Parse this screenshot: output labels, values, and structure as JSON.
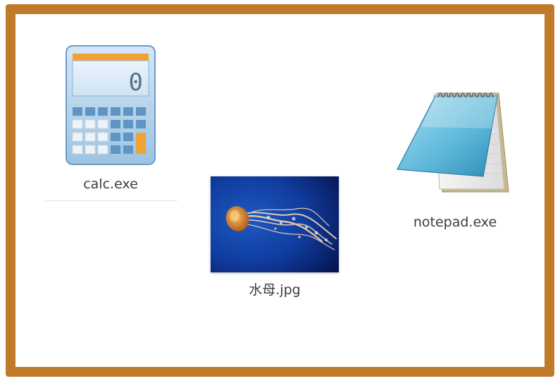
{
  "desktop": {
    "items": [
      {
        "label": "calc.exe",
        "icon": "calculator-icon",
        "display_value": "0"
      },
      {
        "label": "水母.jpg",
        "icon": "jellyfish-photo-thumbnail"
      },
      {
        "label": "notepad.exe",
        "icon": "notepad-icon"
      }
    ]
  },
  "colors": {
    "frame": "#c07a2c",
    "calculator_body": "#bcd8ee",
    "calculator_accent": "#f0a334",
    "photo_background": "#0b1f78",
    "jellyfish": "#e39a3c"
  }
}
